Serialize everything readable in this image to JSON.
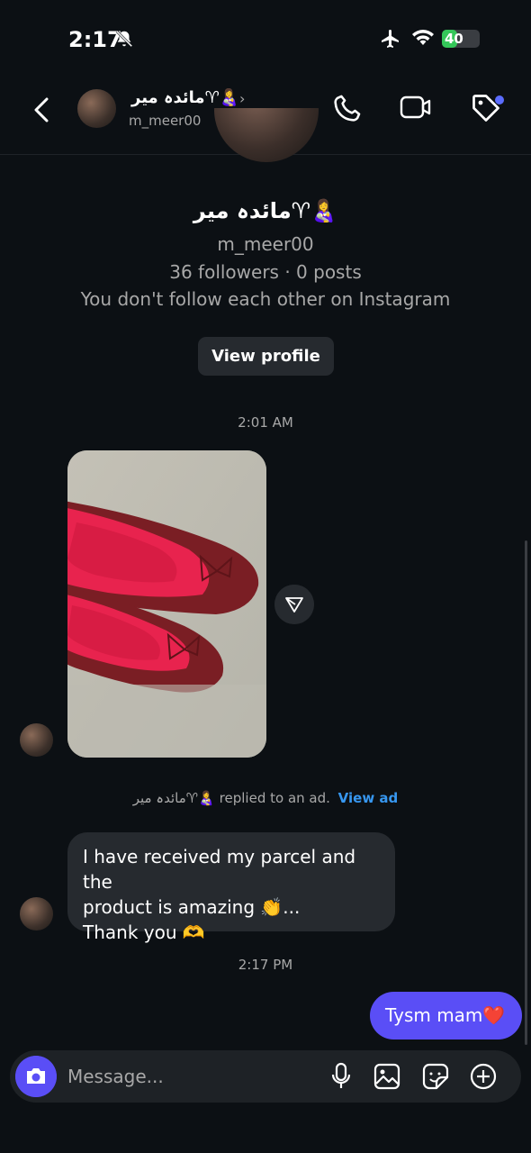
{
  "status_bar": {
    "time": "2:17",
    "battery": "40",
    "battery_level": 0.4
  },
  "header": {
    "name": "مائدہ میر♈👩‍🍼",
    "username": "m_meer00"
  },
  "profile": {
    "name": "مائدہ میر♈👩‍🍼",
    "username": "m_meer00",
    "stats": "36 followers · 0 posts",
    "follow_status": "You don't follow each other on Instagram",
    "view_profile_label": "View profile"
  },
  "thread": {
    "timestamp_1": "2:01 AM",
    "ad_reply": {
      "sender": "مائدہ میر♈👩‍🍼",
      "text": "replied to an ad.",
      "link": "View ad"
    },
    "incoming_message": {
      "line1": "I have received my parcel and the",
      "line2": "product is amazing 👏...",
      "line3": "Thank you 🫶"
    },
    "timestamp_2": "2:17 PM",
    "outgoing_message": "Tysm mam❤️"
  },
  "composer": {
    "placeholder": "Message..."
  },
  "colors": {
    "background": "#0c1014",
    "bubble_in": "#262a2f",
    "bubble_out": "#5a4ef6",
    "link": "#3797f0"
  }
}
